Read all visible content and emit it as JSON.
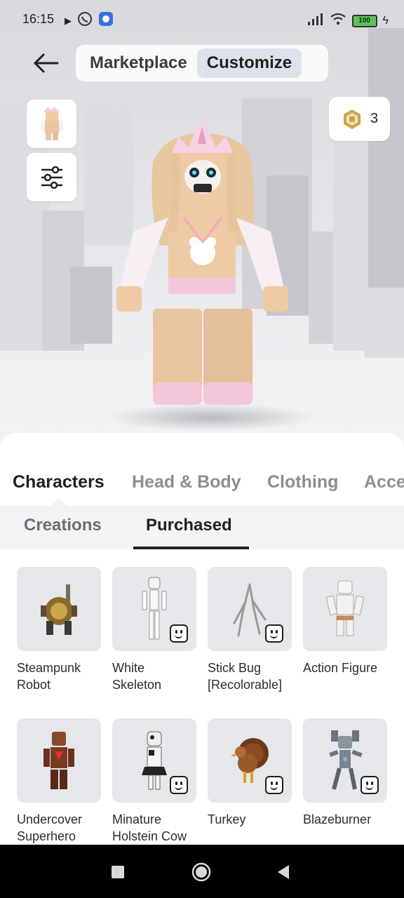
{
  "status_bar": {
    "time": "16:15",
    "battery": "100",
    "icons": [
      "play-icon",
      "viber-icon",
      "app-icon",
      "signal-icon",
      "wifi-icon",
      "battery-icon",
      "charging-icon"
    ]
  },
  "header": {
    "tabs": [
      {
        "label": "Marketplace",
        "active": false
      },
      {
        "label": "Customize",
        "active": true
      }
    ]
  },
  "robux": {
    "count": "3"
  },
  "categories": [
    {
      "label": "Characters",
      "active": true
    },
    {
      "label": "Head & Body",
      "active": false
    },
    {
      "label": "Clothing",
      "active": false
    },
    {
      "label": "Acce",
      "active": false
    }
  ],
  "subtabs": [
    {
      "label": "Creations",
      "active": false
    },
    {
      "label": "Purchased",
      "active": true
    }
  ],
  "items": [
    {
      "name_l1": "Steampunk",
      "name_l2": "Robot",
      "has_badge": false
    },
    {
      "name_l1": "White",
      "name_l2": "Skeleton",
      "has_badge": true
    },
    {
      "name_l1": "Stick Bug",
      "name_l2": "[Recolorable]",
      "has_badge": true
    },
    {
      "name_l1": "Action Figure",
      "name_l2": "",
      "has_badge": false
    },
    {
      "name_l1": "Undercover",
      "name_l2": "Superhero",
      "has_badge": false
    },
    {
      "name_l1": "Minature",
      "name_l2": "Holstein Cow",
      "has_badge": true
    },
    {
      "name_l1": "Turkey",
      "name_l2": "",
      "has_badge": true
    },
    {
      "name_l1": "Blazeburner",
      "name_l2": "",
      "has_badge": true
    }
  ],
  "colors": {
    "accent_text": "#1e2021",
    "muted_text": "#8b8e93",
    "tile_bg": "#e6e7ea",
    "subbar_bg": "#f2f3f5"
  }
}
